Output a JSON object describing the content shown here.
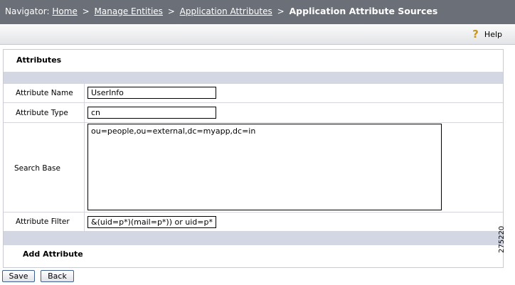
{
  "navigator": {
    "prefix": "Navigator:",
    "crumbs": [
      "Home",
      "Manage Entities",
      "Application Attributes"
    ],
    "separator": ">",
    "current": "Application Attribute Sources"
  },
  "toolbar": {
    "help_label": "Help",
    "help_icon": "question-mark-icon"
  },
  "panel": {
    "title": "Attributes",
    "fields": {
      "attribute_name": {
        "label": "Attribute Name",
        "value": "UserInfo"
      },
      "attribute_type": {
        "label": "Attribute Type",
        "value": "cn"
      },
      "search_base": {
        "label": "Search Base",
        "value": "ou=people,ou=external,dc=myapp,dc=in"
      },
      "attribute_filter": {
        "label": "Attribute Filter",
        "value": "&(uid=p*)(mail=p*)) or uid=p*"
      }
    },
    "add_attribute": "Add Attribute"
  },
  "buttons": {
    "save": "Save",
    "back": "Back"
  },
  "figure_number": "275220",
  "colors": {
    "navbar": "#6b6f78",
    "band": "#d3d6e3",
    "help_icon": "#c9961a"
  }
}
